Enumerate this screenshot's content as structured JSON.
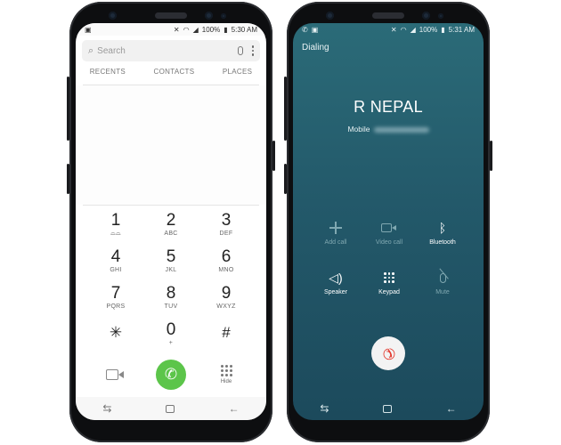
{
  "left_phone": {
    "status": {
      "time": "5:30 AM",
      "battery": "100%"
    },
    "search": {
      "placeholder": "Search"
    },
    "tabs": [
      "RECENTS",
      "CONTACTS",
      "PLACES"
    ],
    "keys": [
      {
        "digit": "1",
        "letters": ""
      },
      {
        "digit": "2",
        "letters": "ABC"
      },
      {
        "digit": "3",
        "letters": "DEF"
      },
      {
        "digit": "4",
        "letters": "GHI"
      },
      {
        "digit": "5",
        "letters": "JKL"
      },
      {
        "digit": "6",
        "letters": "MNO"
      },
      {
        "digit": "7",
        "letters": "PQRS"
      },
      {
        "digit": "8",
        "letters": "TUV"
      },
      {
        "digit": "9",
        "letters": "WXYZ"
      },
      {
        "digit": "✳",
        "letters": ""
      },
      {
        "digit": "0",
        "letters": "+"
      },
      {
        "digit": "#",
        "letters": ""
      }
    ],
    "hide_label": "Hide",
    "call_button_color": "#5cc54a"
  },
  "right_phone": {
    "status": {
      "time": "5:31 AM",
      "battery": "100%"
    },
    "state_label": "Dialing",
    "callee_name": "R NEPAL",
    "callee_type": "Mobile",
    "controls": [
      {
        "label": "Add call",
        "icon": "plus-icon",
        "enabled": false
      },
      {
        "label": "Video call",
        "icon": "video-icon",
        "enabled": false
      },
      {
        "label": "Bluetooth",
        "icon": "bluetooth-icon",
        "enabled": true
      },
      {
        "label": "Speaker",
        "icon": "speaker-icon",
        "enabled": true
      },
      {
        "label": "Keypad",
        "icon": "keypad-icon",
        "enabled": true
      },
      {
        "label": "Mute",
        "icon": "mute-icon",
        "enabled": false
      }
    ],
    "end_call_color": "#e3372c",
    "background_color": "#23596a"
  }
}
